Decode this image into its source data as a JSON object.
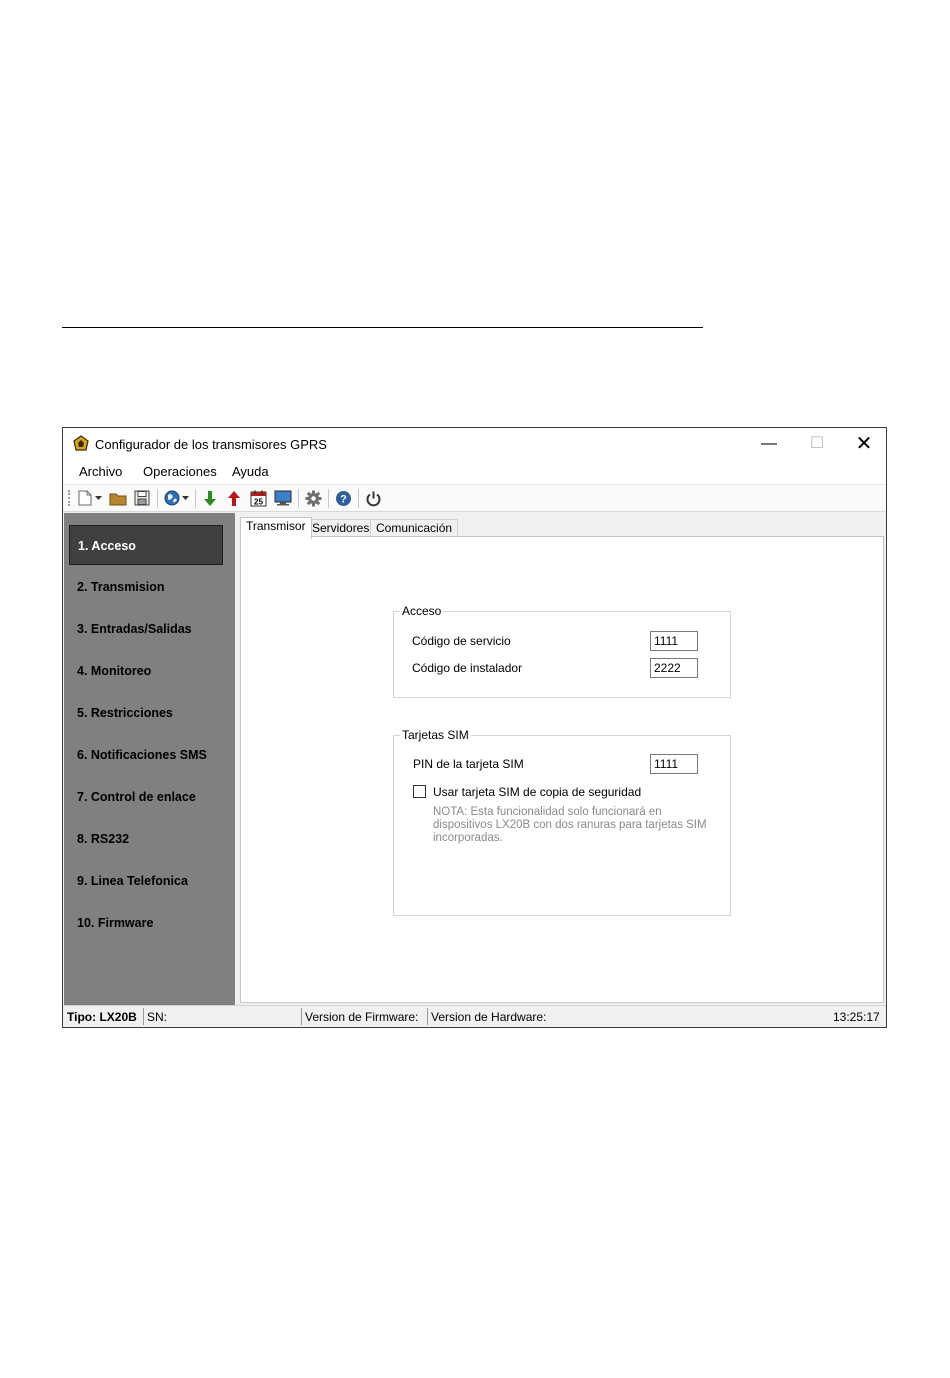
{
  "window": {
    "title": "Configurador de los transmisores GPRS"
  },
  "menu": [
    "Archivo",
    "Operaciones",
    "Ayuda"
  ],
  "toolbar": {
    "icons": [
      "new-file-icon",
      "dropdown-arrow-icon",
      "open-folder-icon",
      "save-icon",
      "globe-icon",
      "dropdown-arrow-icon",
      "download-arrow-icon",
      "upload-arrow-icon",
      "calendar-icon",
      "monitor-icon",
      "gear-icon",
      "help-icon",
      "power-icon"
    ],
    "calendar_day": "25"
  },
  "sidebar": {
    "items": [
      "1. Acceso",
      "2. Transmision",
      "3. Entradas/Salidas",
      "4. Monitoreo",
      "5. Restricciones",
      "6. Notificaciones SMS",
      "7. Control de enlace",
      "8. RS232",
      "9. Linea Telefonica",
      "10. Firmware"
    ],
    "active_index": 0
  },
  "tabs": [
    "Transmisor",
    "Servidores",
    "Comunicación"
  ],
  "acceso": {
    "title": "Acceso",
    "servicio_label": "Código de servicio",
    "servicio_value": "1111",
    "instalador_label": "Código de instalador",
    "instalador_value": "2222"
  },
  "sim": {
    "title": "Tarjetas SIM",
    "pin_label": "PIN de la tarjeta SIM",
    "pin_value": "1111",
    "backup_label": "Usar tarjeta SIM de copia de seguridad",
    "backup_checked": false,
    "note": "NOTA: Esta funcionalidad solo funcionará en dispositivos LX20B con dos ranuras para tarjetas SIM incorporadas."
  },
  "status": {
    "tipo": "Tipo: LX20B",
    "sn": "SN:",
    "firmware": "Version de Firmware:",
    "hardware": "Version de Hardware:",
    "time": "13:25:17"
  },
  "colors": {
    "sidebar_bg": "#808080",
    "active_item_bg": "#404040",
    "download": "#2e8b1f",
    "upload": "#c0141b"
  }
}
